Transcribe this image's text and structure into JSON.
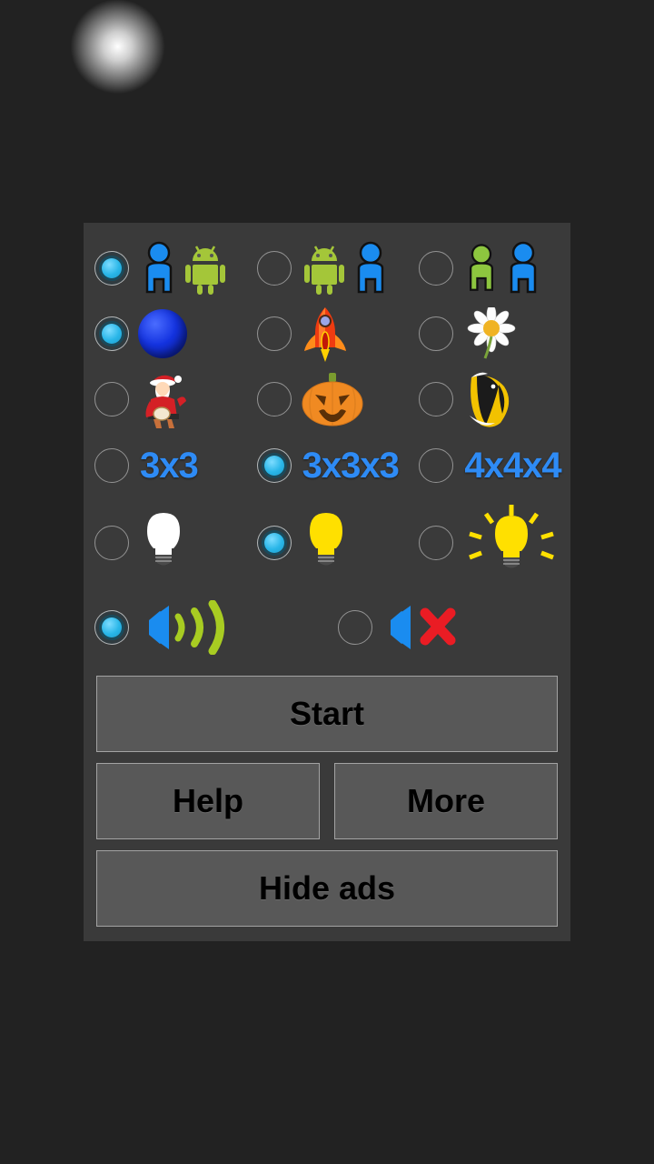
{
  "app": {
    "background": "grey-bubbles-texture",
    "accent_selected": "#29b6e8",
    "accent_text": "#2e8bf5"
  },
  "panel": {
    "option_groups": [
      {
        "name": "players",
        "options": [
          {
            "id": "human-vs-android",
            "icon": "person-blue-and-android-green-icon",
            "selected": true,
            "label": ""
          },
          {
            "id": "android-vs-human",
            "icon": "android-green-and-person-blue-icon",
            "selected": false,
            "label": ""
          },
          {
            "id": "human-vs-human",
            "icon": "person-green-and-person-blue-icon",
            "selected": false,
            "label": ""
          }
        ]
      },
      {
        "name": "piece-theme",
        "options": [
          {
            "id": "ball",
            "icon": "blue-ball-icon",
            "selected": true,
            "label": ""
          },
          {
            "id": "rocket",
            "icon": "rocket-icon",
            "selected": false,
            "label": ""
          },
          {
            "id": "flower",
            "icon": "daisy-flower-icon",
            "selected": false,
            "label": ""
          }
        ]
      },
      {
        "name": "seasonal-theme",
        "options": [
          {
            "id": "santa",
            "icon": "santa-claus-icon",
            "selected": false,
            "label": ""
          },
          {
            "id": "pumpkin",
            "icon": "jack-o-lantern-icon",
            "selected": false,
            "label": ""
          },
          {
            "id": "fish",
            "icon": "tropical-fish-icon",
            "selected": false,
            "label": ""
          }
        ]
      },
      {
        "name": "board-size",
        "options": [
          {
            "id": "3x3",
            "icon": "",
            "selected": false,
            "label": "3x3"
          },
          {
            "id": "3x3x3",
            "icon": "",
            "selected": true,
            "label": "3x3x3"
          },
          {
            "id": "4x4x4",
            "icon": "",
            "selected": false,
            "label": "4x4x4"
          }
        ]
      },
      {
        "name": "difficulty",
        "options": [
          {
            "id": "easy",
            "icon": "lightbulb-off-white-icon",
            "selected": false,
            "label": ""
          },
          {
            "id": "medium",
            "icon": "lightbulb-on-yellow-icon",
            "selected": true,
            "label": ""
          },
          {
            "id": "hard",
            "icon": "lightbulb-bright-rays-icon",
            "selected": false,
            "label": ""
          }
        ]
      },
      {
        "name": "sound",
        "options": [
          {
            "id": "sound-on",
            "icon": "speaker-with-waves-icon",
            "selected": true,
            "label": ""
          },
          {
            "id": "sound-off",
            "icon": "speaker-muted-x-icon",
            "selected": false,
            "label": ""
          }
        ]
      }
    ],
    "buttons": {
      "start": "Start",
      "help": "Help",
      "more": "More",
      "hide_ads": "Hide ads"
    }
  }
}
